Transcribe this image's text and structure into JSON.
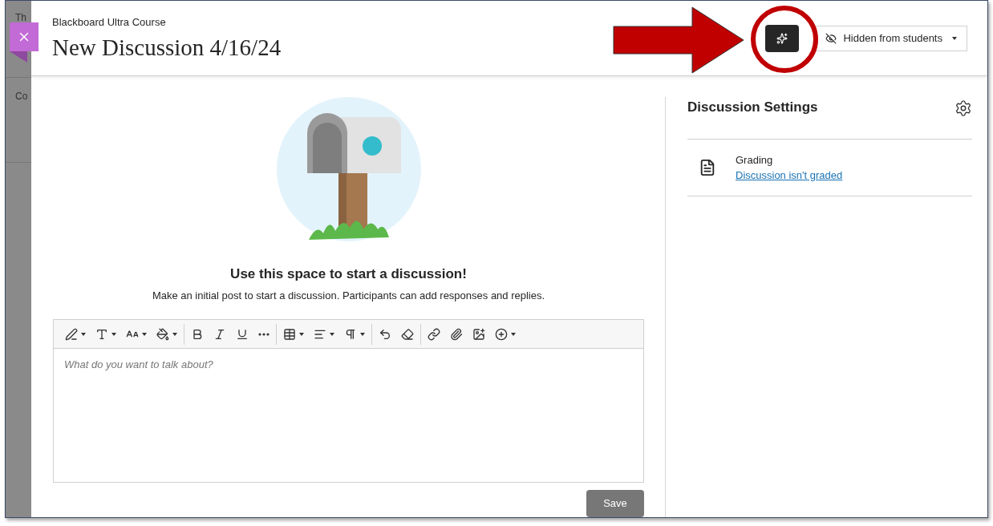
{
  "background": {
    "texts": [
      "Th",
      "Co"
    ]
  },
  "header": {
    "course": "Blackboard Ultra Course",
    "title": "New Discussion 4/16/24",
    "visibility": "Hidden from students"
  },
  "empty_state": {
    "heading": "Use this space to start a discussion!",
    "text": "Make an initial post to start a discussion. Participants can add responses and replies."
  },
  "editor": {
    "placeholder": "What do you want to talk about?",
    "toolbar_groups": [
      [
        {
          "dropdown": true
        },
        {
          "dropdown": true
        },
        {
          "dropdown": true
        },
        {
          "dropdown": true
        }
      ],
      [
        {
          "dropdown": false
        },
        {
          "dropdown": false
        },
        {
          "dropdown": false
        },
        {
          "dropdown": false
        }
      ],
      [
        {
          "dropdown": true
        },
        {
          "dropdown": true
        },
        {
          "dropdown": true
        }
      ],
      [
        {
          "dropdown": false
        },
        {
          "dropdown": false
        }
      ],
      [
        {
          "dropdown": false
        },
        {
          "dropdown": false
        },
        {
          "dropdown": false
        },
        {
          "dropdown": true
        }
      ]
    ]
  },
  "save_button": "Save",
  "settings": {
    "title": "Discussion Settings",
    "items": [
      {
        "label": "Grading",
        "link": "Discussion isn't graded"
      }
    ]
  }
}
